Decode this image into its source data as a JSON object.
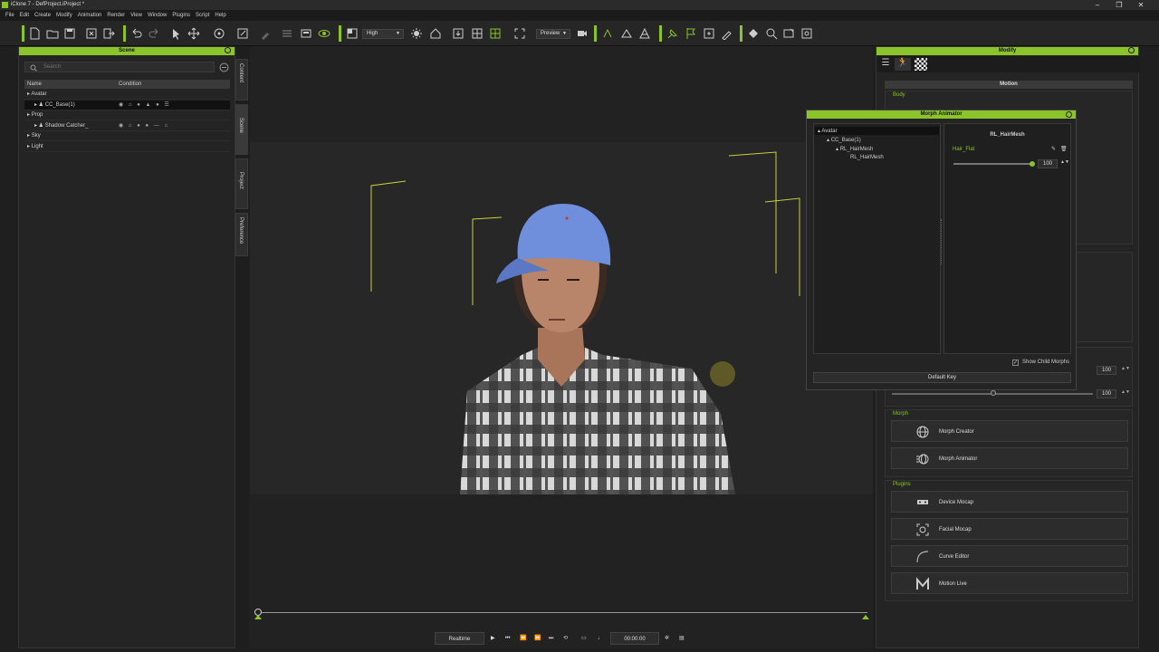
{
  "window": {
    "title": "iClone 7 - DefProject.iProject *",
    "controls": [
      "–",
      "❐",
      "✕"
    ]
  },
  "menu": [
    "File",
    "Edit",
    "Create",
    "Modify",
    "Animation",
    "Render",
    "View",
    "Window",
    "Plugins",
    "Script",
    "Help"
  ],
  "toolbar": {
    "quality": "High",
    "preview": "Preview"
  },
  "scene_panel": {
    "title": "Scene",
    "search_placeholder": "Search",
    "columns": [
      "Name",
      "Condition"
    ],
    "rows": [
      {
        "label": "Avatar",
        "indent": 0,
        "selected": false
      },
      {
        "label": "CC_Base(1)",
        "indent": 1,
        "selected": true,
        "condition": "◉ ⌂ ● ▲ ● ☰"
      },
      {
        "label": "Prop",
        "indent": 0,
        "selected": false
      },
      {
        "label": "Shadow Catcher_",
        "indent": 1,
        "selected": false,
        "condition": "◉ ⌂ ● ● — ⌂"
      },
      {
        "label": "Sky",
        "indent": 0,
        "selected": false
      },
      {
        "label": "Light",
        "indent": 0,
        "selected": false
      }
    ]
  },
  "side_tabs": [
    "Content",
    "Scene",
    "Project",
    "Preference"
  ],
  "playback": {
    "mode": "Realtime",
    "time": "00:00:00"
  },
  "modify_panel": {
    "title": "Modify",
    "section": "Motion",
    "body_label": "Body",
    "values": [
      "100",
      "100"
    ],
    "morph_label": "Morph",
    "morph_buttons": [
      "Morph Creator",
      "Morph Animator"
    ],
    "plugins_label": "Plugins",
    "plugin_buttons": [
      "Device Mocap",
      "Facial Mocap",
      "Curve Editor",
      "Motion Live"
    ]
  },
  "morph_animator": {
    "title": "Morph Animator",
    "tree": [
      "Avatar",
      "CC_Base(1)",
      "RL_HairMesh",
      "RL_HairMesh"
    ],
    "right_title": "RL_HairMesh",
    "morph_name": "Hair_Flat",
    "morph_value": "100",
    "show_child": "Show Child Morphs",
    "default_key": "Default Key"
  },
  "colors": {
    "accent": "#8bc32b",
    "cap": "#6f8fdc"
  }
}
